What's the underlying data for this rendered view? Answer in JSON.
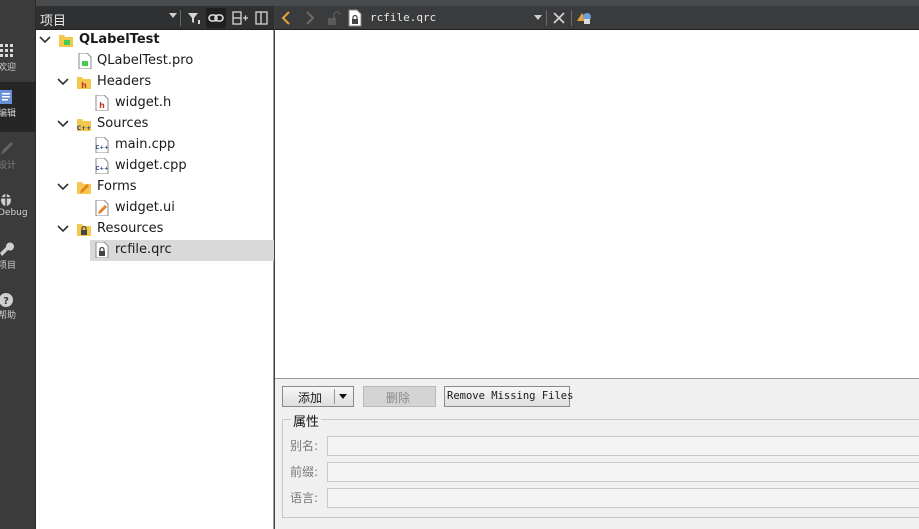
{
  "mode_bar": {
    "items": [
      {
        "label": "欢迎",
        "icon": "grid-icon"
      },
      {
        "label": "编辑",
        "icon": "edit-document-icon"
      },
      {
        "label": "设计",
        "icon": "pencil-icon"
      },
      {
        "label": "Debug",
        "icon": "bug-icon"
      },
      {
        "label": "项目",
        "icon": "wrench-icon"
      },
      {
        "label": "帮助",
        "icon": "help-icon"
      }
    ]
  },
  "project_pane": {
    "title": "项目",
    "tree": [
      {
        "name": "QLabelTest",
        "icon": "project-icon",
        "level": 0,
        "expanded": true
      },
      {
        "name": "QLabelTest.pro",
        "icon": "pro-file-icon",
        "level": 1
      },
      {
        "name": "Headers",
        "icon": "headers-folder-icon",
        "level": 1,
        "expanded": true
      },
      {
        "name": "widget.h",
        "icon": "header-file-icon",
        "level": 2
      },
      {
        "name": "Sources",
        "icon": "sources-folder-icon",
        "level": 1,
        "expanded": true
      },
      {
        "name": "main.cpp",
        "icon": "cpp-file-icon",
        "level": 2
      },
      {
        "name": "widget.cpp",
        "icon": "cpp-file-icon",
        "level": 2
      },
      {
        "name": "Forms",
        "icon": "forms-folder-icon",
        "level": 1,
        "expanded": true
      },
      {
        "name": "widget.ui",
        "icon": "ui-file-icon",
        "level": 2
      },
      {
        "name": "Resources",
        "icon": "resources-folder-icon",
        "level": 1,
        "expanded": true
      },
      {
        "name": "rcfile.qrc",
        "icon": "qrc-file-icon",
        "level": 2,
        "selected": true
      }
    ]
  },
  "editor_toolbar": {
    "file_name": "rcfile.qrc"
  },
  "resource_editor": {
    "add_label": "添加",
    "remove_label": "删除",
    "remove_missing_label": "Remove Missing Files",
    "properties_title": "属性",
    "alias_label": "别名:",
    "alias_value": "",
    "prefix_label": "前缀:",
    "prefix_value": "",
    "language_label": "语言:",
    "language_value": ""
  },
  "colors": {
    "accent": "#e8a33d",
    "dark_bg": "#3a3b3d",
    "selection": "#d9d9d9"
  }
}
